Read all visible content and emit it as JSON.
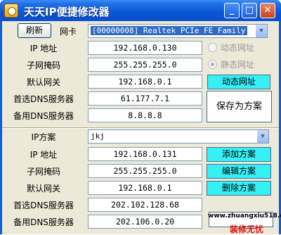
{
  "window": {
    "title": "天天IP便捷修改器",
    "min": "_",
    "max": "□",
    "close": "✕"
  },
  "top": {
    "refresh_label": "刷新",
    "nic_label": "网卡",
    "nic_value": "[00000008] Realtek PCIe FE Family"
  },
  "current": {
    "rows": [
      {
        "label": "IP 地址",
        "value": "192.168.0.130"
      },
      {
        "label": "子网掩码",
        "value": "255.255.255.0"
      },
      {
        "label": "默认网关",
        "value": "192.168.0.1"
      },
      {
        "label": "首选DNS服务器",
        "value": "61.177.7.1"
      },
      {
        "label": "备用DNS服务器",
        "value": "8.8.8.8"
      }
    ],
    "dynamic_label": "动态网址",
    "static_label": "静态网址",
    "dynamic_button": "动态网址",
    "save_button": "保存为方案"
  },
  "scheme": {
    "label": "IP方案",
    "value": "jkj",
    "rows": [
      {
        "label": "IP 地址",
        "value": "192.168.0.131"
      },
      {
        "label": "子网掩码",
        "value": "255.255.255.0"
      },
      {
        "label": "默认网关",
        "value": "192.168.0.1"
      },
      {
        "label": "首选DNS服务器",
        "value": "202.102.128.68"
      },
      {
        "label": "备用DNS服务器",
        "value": "202.106.0.20"
      }
    ],
    "add_button": "添加方案",
    "edit_button": "编辑方案",
    "delete_button": "删除方案"
  },
  "watermark": {
    "url": "www.zhuangxiu518.com",
    "text": "装修无忧"
  }
}
